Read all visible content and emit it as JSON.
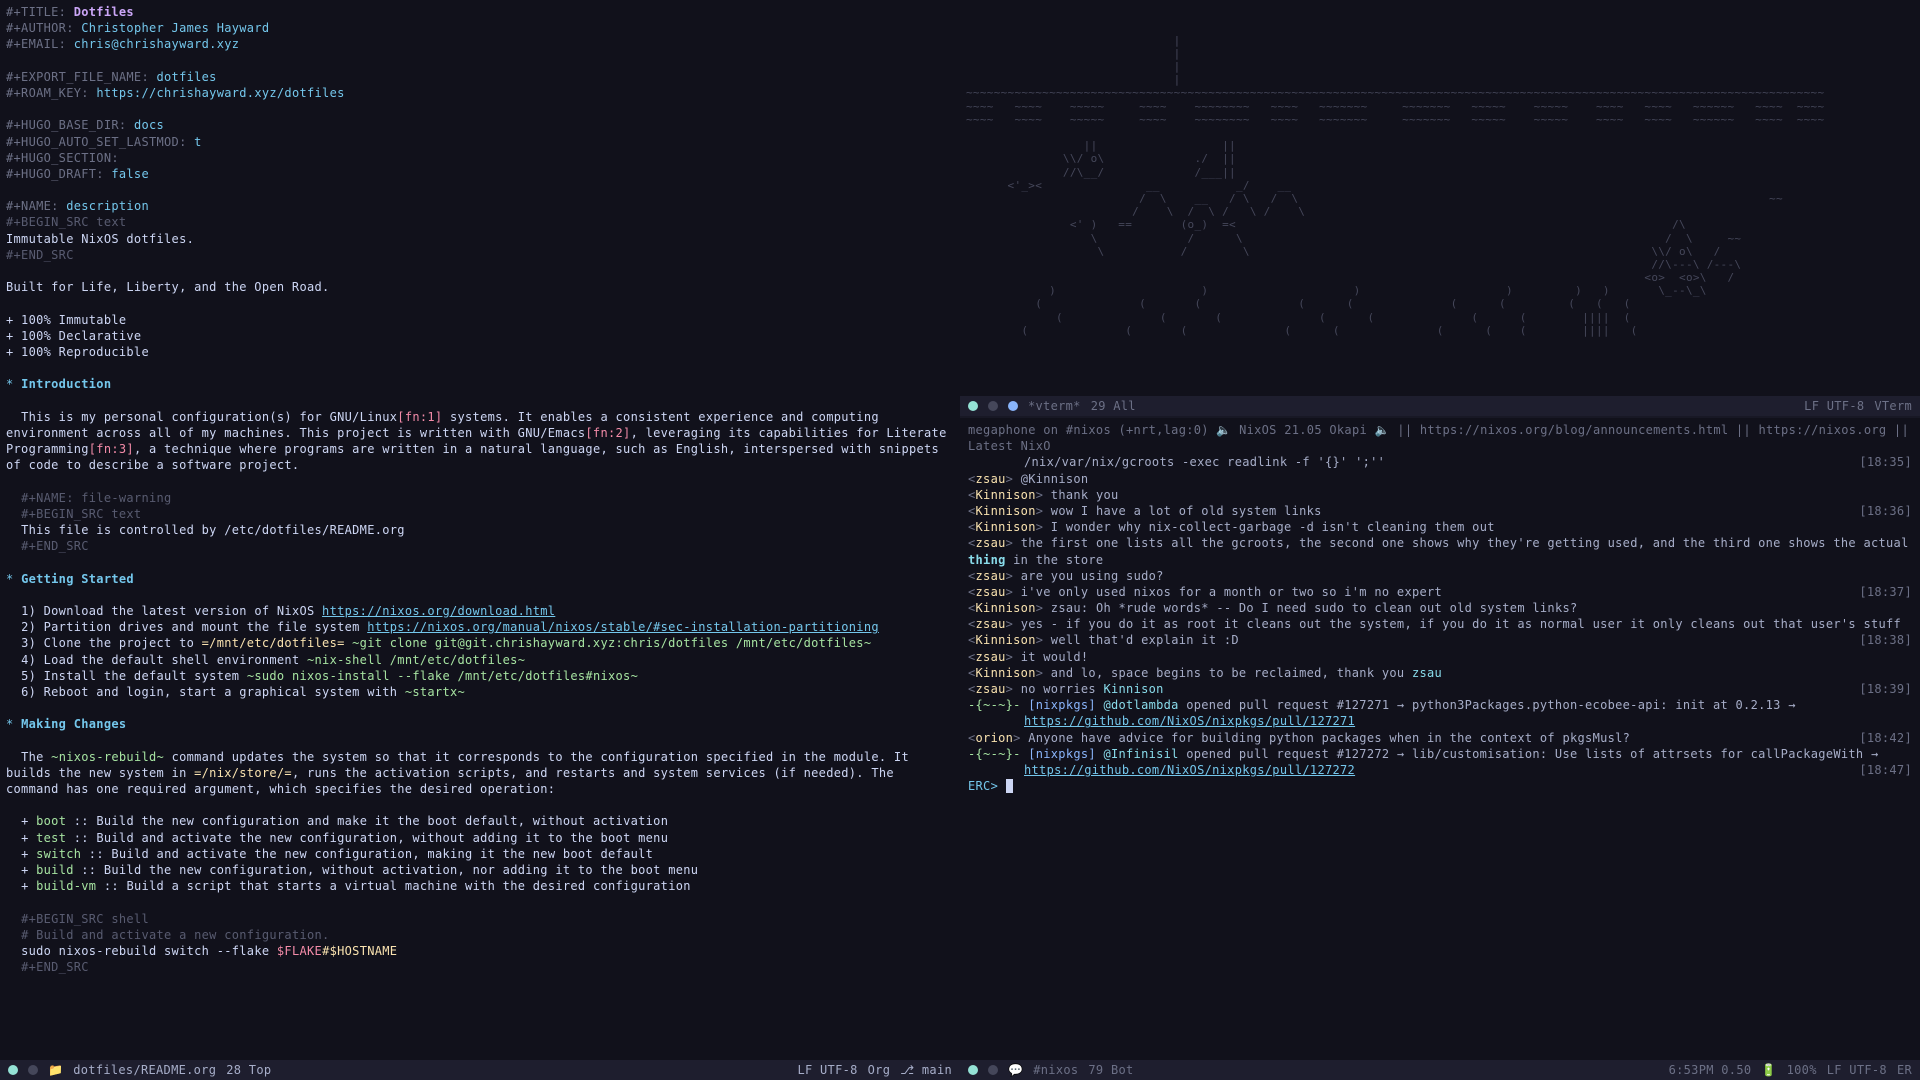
{
  "left": {
    "header": {
      "title_kw": "#+TITLE:",
      "title_val": "Dotfiles",
      "author_kw": "#+AUTHOR:",
      "author_val": "Christopher James Hayward",
      "email_kw": "#+EMAIL:",
      "email_val": "chris@chrishayward.xyz"
    },
    "export": {
      "fname_kw": "#+EXPORT_FILE_NAME:",
      "fname_val": "dotfiles",
      "roam_kw": "#+ROAM_KEY:",
      "roam_val": "https://chrishayward.xyz/dotfiles"
    },
    "hugo": {
      "base_kw": "#+HUGO_BASE_DIR:",
      "base_val": "docs",
      "lastmod_kw": "#+HUGO_AUTO_SET_LASTMOD:",
      "lastmod_val": "t",
      "section_kw": "#+HUGO_SECTION:",
      "draft_kw": "#+HUGO_DRAFT:",
      "draft_val": "false"
    },
    "desc_block": {
      "name_kw": "#+NAME:",
      "name_val": "description",
      "begin": "#+BEGIN_SRC text",
      "body": "Immutable NixOS dotfiles.",
      "end": "#+END_SRC"
    },
    "tagline": "Built for Life, Liberty, and the Open Road.",
    "bullets_top": [
      "+ 100% Immutable",
      "+ 100% Declarative",
      "+ 100% Reproducible"
    ],
    "intro_heading": "Introduction",
    "intro_p1a": "This is my personal configuration(s) for GNU/Linux",
    "intro_fn1": "[fn:1]",
    "intro_p1b": " systems. It enables a consistent experience and computing environment across all of my machines. This project is written with GNU/Emacs",
    "intro_fn2": "[fn:2]",
    "intro_p1c": ", leveraging its capabilities for Literate Programming",
    "intro_fn3": "[fn:3]",
    "intro_p1d": ", a technique where programs are written in a natural language, such as English, interspersed with snippets of code to describe a software project.",
    "file_warning": {
      "name_kw": "#+NAME:",
      "name_val": "file-warning",
      "begin": "#+BEGIN_SRC text",
      "body": "This file is controlled by /etc/dotfiles/README.org",
      "end": "#+END_SRC"
    },
    "getting_started_heading": "Getting Started",
    "steps": {
      "s1a": "1) Download the latest version of NixOS ",
      "s1link": "https://nixos.org/download.html",
      "s2a": "2) Partition drives and mount the file system ",
      "s2link": "https://nixos.org/manual/nixos/stable/#sec-installation-partitioning",
      "s3a": "3) Clone the project to ",
      "s3path": "=/mnt/etc/dotfiles=",
      "s3cmd": " ~git clone git@git.chrishayward.xyz:chris/dotfiles /mnt/etc/dotfiles~",
      "s4a": "4) Load the default shell environment ",
      "s4cmd": "~nix-shell /mnt/etc/dotfiles~",
      "s5a": "5) Install the default system ",
      "s5cmd": "~sudo nixos-install --flake /mnt/etc/dotfiles#nixos~",
      "s6a": "6) Reboot and login, start a graphical system with ",
      "s6cmd": "~startx~"
    },
    "making_heading": "Making Changes",
    "making_p1a": "The ",
    "making_cmd": "~nixos-rebuild~",
    "making_p1b": " command updates the system so that it corresponds to the configuration specified in the module. It builds the new system in ",
    "making_path": "=/nix/store/=",
    "making_p1c": ", runs the activation scripts, and restarts and system services (if needed). The command has one required argument, which specifies the desired operation:",
    "make_ops": [
      {
        "cmd": "boot",
        "desc": "Build the new configuration and make it the boot default, without activation"
      },
      {
        "cmd": "test",
        "desc": "Build and activate the new configuration, without adding it to the boot menu"
      },
      {
        "cmd": "switch",
        "desc": "Build and activate the new configuration, making it the new boot default"
      },
      {
        "cmd": "build",
        "desc": "Build the new configuration, without activation, nor adding it to the boot menu"
      },
      {
        "cmd": "build-vm",
        "desc": "Build a script that starts a virtual machine with the desired configuration"
      }
    ],
    "final_src": {
      "begin": "#+BEGIN_SRC shell",
      "comment": "# Build and activate a new configuration.",
      "cmd_a": "sudo nixos-rebuild switch --flake ",
      "flake": "$FLAKE",
      "hash": "#",
      "host": "$HOSTNAME",
      "end": "#+END_SRC"
    },
    "modeline": {
      "buffer": "dotfiles/README.org",
      "pos": "28 Top",
      "enc": "LF UTF-8",
      "mode": "Org",
      "branch": "main"
    }
  },
  "vterm": {
    "ascii": "                              |\n                              |\n                              |\n                              |\n~~~~~~~~~~~~~~~~~~~~~~~~~~~~~~~~~~~~~~~~~~~~~~~~~~~~~~~~~~~~~~~~~~~~~~~~~~~~~~~~~~~~~~~~~~~~~~~~~~~~~~~~~~~~~~~~~~~~~~~~~~~~\n~~~~   ~~~~    ~~~~~     ~~~~    ~~~~~~~~   ~~~~   ~~~~~~~     ~~~~~~~   ~~~~~    ~~~~~    ~~~~   ~~~~   ~~~~~~   ~~~~  ~~~~\n~~~~   ~~~~    ~~~~~     ~~~~    ~~~~~~~~   ~~~~   ~~~~~~~     ~~~~~~~   ~~~~~    ~~~~~    ~~~~   ~~~~   ~~~~~~   ~~~~  ~~~~\n                                                                                                                           \n                 ||                  ||                                                                                    \n              \\\\/ o\\             ./  ||                                                                                    \n              //\\__/             /___||                                                                                    \n      <'_><               __           _/    __                                                                            \n                         /  \\    __   / \\   /  \\                                                                    ~~     \n                        /    \\  /  \\ /   \\ /    \\                                                                          \n               <' )   ==       (o_)  =<                                                               /\\                   \n                  \\             /      \\                                                             /  \\     ~~          \n                   \\           /        \\                                                          \\\\/ o\\   /              \n                                                                                                   //\\---\\ /---\\           \n                                                                                                  <o>  <o>\\   /            \n            )                     )                     )                     )         )   )       \\_--\\_\\              \n          (              (       (              (      (              (      (         (   (   (                           \n             (              (       (              (      (              (      (        ||||  (                           \n        (              (       (              (      (              (      (    (        ||||   (                          ",
    "modeline": {
      "buffer": "*vterm*",
      "pos": "29 All",
      "enc": "LF UTF-8",
      "mode": "VTerm"
    }
  },
  "erc": {
    "topic_a": "megaphone on #nixos (+nrt,lag:0) ",
    "topic_b": " NixOS 21.05 Okapi ",
    "topic_c": " || https://nixos.org/blog/announcements.html || https://nixos.org || Latest NixO",
    "topic_d": "/nix/var/nix/gcroots -exec readlink -f '{}' ';''",
    "topic_time": "[18:35]",
    "lines": [
      {
        "nick": "zsau",
        "txt": "@Kinnison"
      },
      {
        "nick": "Kinnison",
        "txt": "thank you"
      },
      {
        "nick": "Kinnison",
        "txt": "wow I have a lot of old system links",
        "time": "[18:36]"
      },
      {
        "nick": "Kinnison",
        "txt": "I wonder why nix-collect-garbage -d isn't cleaning them out"
      },
      {
        "nick": "zsau",
        "txt": "the first one lists all the gcroots, the second one shows why they're getting used, and the third one shows the actual thing in the store",
        "thing": true
      },
      {
        "nick": "zsau",
        "txt": "are you using sudo?"
      },
      {
        "nick": "zsau",
        "txt": "i've only used nixos for a month or two so i'm no expert",
        "time": "[18:37]"
      },
      {
        "nick": "Kinnison",
        "txt": "zsau: Oh *rude words* -- Do I need sudo to clean out old system links?"
      },
      {
        "nick": "zsau",
        "txt": "yes - if you do it as root it cleans out the system, if you do it as normal user it only cleans out that user's stuff"
      },
      {
        "nick": "Kinnison",
        "txt": "well that'd explain it :D",
        "time": "[18:38]"
      },
      {
        "nick": "zsau",
        "txt": "it would!"
      },
      {
        "nick": "Kinnison",
        "txt": "and lo, space begins to be reclaimed, thank you zsau",
        "zsau_hl": true
      },
      {
        "nick": "zsau",
        "txt": "no worries Kinnison",
        "kinn_hl": true,
        "time": "[18:39]"
      }
    ],
    "pr1": {
      "prefix": "-{~-~}- ",
      "tag": "[nixpkgs] ",
      "user": "@dotlambda",
      "txt": " opened pull request #127271 → python3Packages.python-ecobee-api: init at 0.2.13 → ",
      "link": "https://github.com/NixOS/nixpkgs/pull/127271"
    },
    "orion": {
      "nick": "orion",
      "txt": "Anyone have advice for building python packages when in the context of pkgsMusl?",
      "time": "[18:42]"
    },
    "pr2": {
      "prefix": "-{~-~}- ",
      "tag": "[nixpkgs] ",
      "user": "@Infinisil",
      "txt": " opened pull request #127272 → lib/customisation: Use lists of attrsets for callPackageWith → ",
      "link": "https://github.com/NixOS/nixpkgs/pull/127272",
      "time": "[18:47]"
    },
    "prompt": "ERC>",
    "modeline": {
      "buffer": "#nixos",
      "pos": "79 Bot",
      "time": "6:53PM 0.50",
      "batt": "100%",
      "enc": "LF UTF-8",
      "mode": "ER"
    }
  }
}
